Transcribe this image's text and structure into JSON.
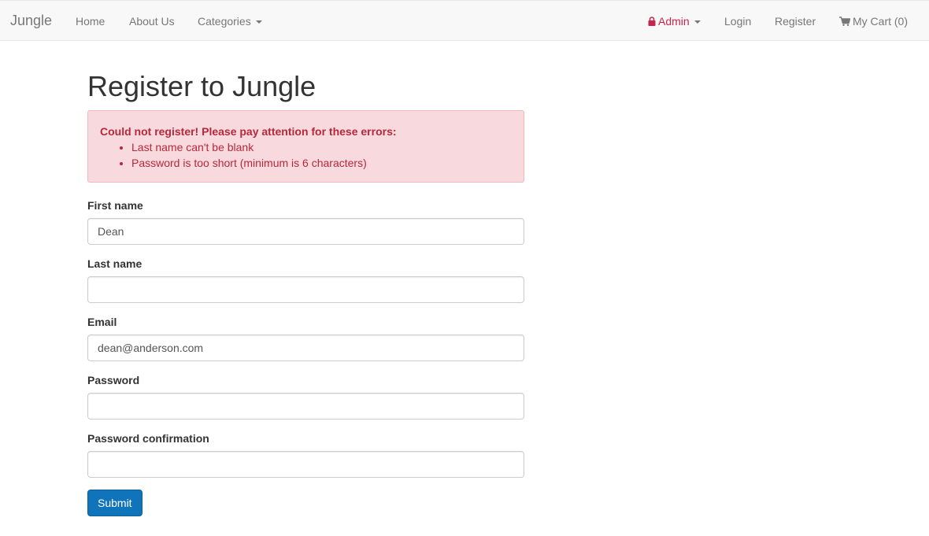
{
  "nav": {
    "brand": "Jungle",
    "links": {
      "home": "Home",
      "about": "About Us",
      "categories": "Categories",
      "admin": "Admin",
      "login": "Login",
      "register": "Register",
      "cart": "My Cart (0)"
    },
    "admin_color": "#c7254e"
  },
  "page": {
    "title": "Register to Jungle"
  },
  "alert": {
    "title": "Could not register! Please pay attention for these errors:",
    "errors": [
      "Last name can't be blank",
      "Password is too short (minimum is 6 characters)"
    ],
    "background": "#f8d9dd",
    "text_color": "#b8283c"
  },
  "form": {
    "first_name": {
      "label": "First name",
      "value": "Dean"
    },
    "last_name": {
      "label": "Last name",
      "value": ""
    },
    "email": {
      "label": "Email",
      "value": "dean@anderson.com"
    },
    "password": {
      "label": "Password",
      "value": ""
    },
    "password_confirmation": {
      "label": "Password confirmation",
      "value": ""
    },
    "submit_label": "Submit",
    "submit_color": "#0f74b9"
  }
}
